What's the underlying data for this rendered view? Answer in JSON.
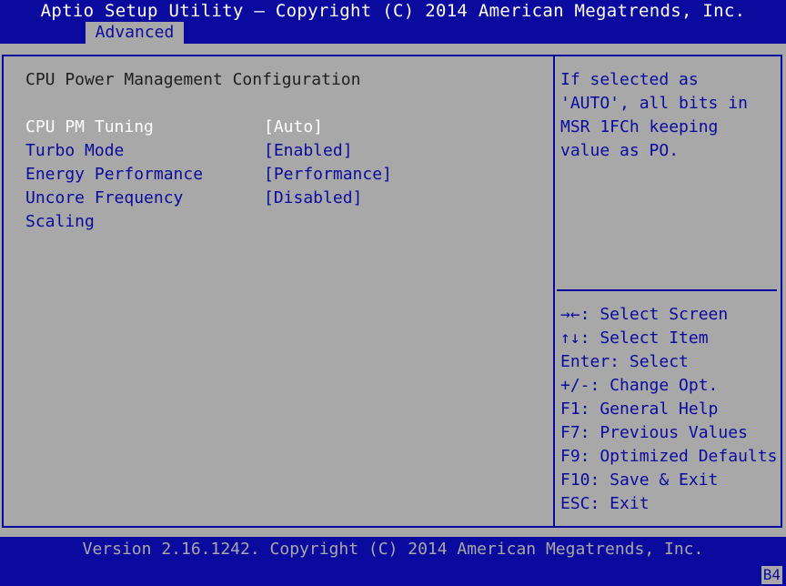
{
  "header": {
    "title": "Aptio Setup Utility – Copyright (C) 2014 American Megatrends, Inc.",
    "tab": "Advanced"
  },
  "main": {
    "page_title": "CPU Power Management Configuration",
    "options": [
      {
        "label": "CPU PM Tuning",
        "value": "[Auto]"
      },
      {
        "label": "Turbo Mode",
        "value": "[Enabled]"
      },
      {
        "label": "Energy Performance",
        "value": "[Performance]"
      },
      {
        "label": "Uncore Frequency",
        "label2": "Scaling",
        "value": "[Disabled]"
      }
    ]
  },
  "help": {
    "description": [
      "If selected as",
      "'AUTO', all bits in",
      "MSR 1FCh keeping",
      "value as PO."
    ],
    "keys": [
      "→←: Select Screen",
      "↑↓: Select Item",
      "Enter: Select",
      "+/-: Change Opt.",
      "F1: General Help",
      "F7: Previous Values",
      "F9: Optimized Defaults",
      "F10: Save & Exit",
      "ESC: Exit"
    ]
  },
  "footer": {
    "version": "Version 2.16.1242. Copyright (C) 2014 American Megatrends, Inc.",
    "code": "B4"
  },
  "colors": {
    "bios_blue": "#0a0a9e",
    "bios_gray": "#a8a8a8",
    "selected_text": "#ffffff"
  }
}
